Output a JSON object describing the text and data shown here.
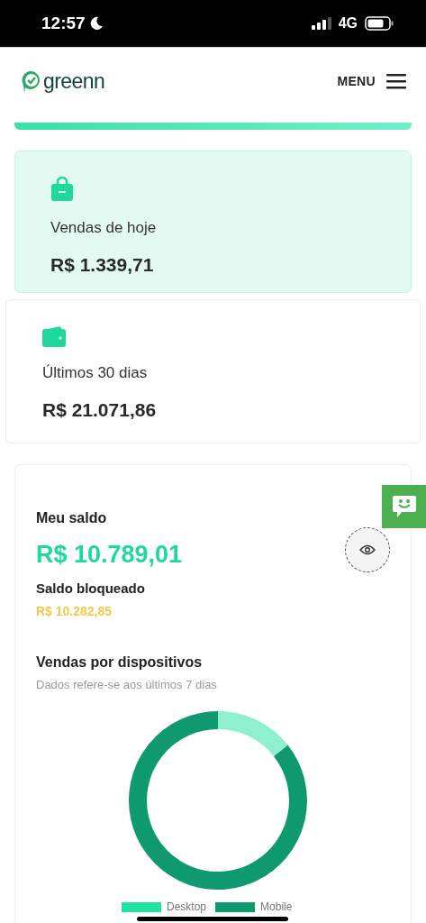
{
  "status_bar": {
    "time": "12:57",
    "network": "4G"
  },
  "header": {
    "logo": "greenn",
    "menu": "MENU"
  },
  "cards": [
    {
      "label": "Vendas de hoje",
      "value": "R$ 1.339,71",
      "kind": "bag"
    },
    {
      "label": "Últimos 30 dias",
      "value": "R$ 21.071,86",
      "kind": "wallet"
    }
  ],
  "balance": {
    "title": "Meu saldo",
    "value": "R$ 10.789,01",
    "blocked_label": "Saldo bloqueado",
    "blocked_value": "R$ 10.282,85"
  },
  "devices": {
    "title": "Vendas por dispositivos",
    "subtitle": "Dados refere-se aos últimos 7 dias",
    "legend": [
      {
        "label": "Desktop",
        "color": "#1ee3a3"
      },
      {
        "label": "Mobile",
        "color": "#0e9a6e"
      }
    ]
  }
}
